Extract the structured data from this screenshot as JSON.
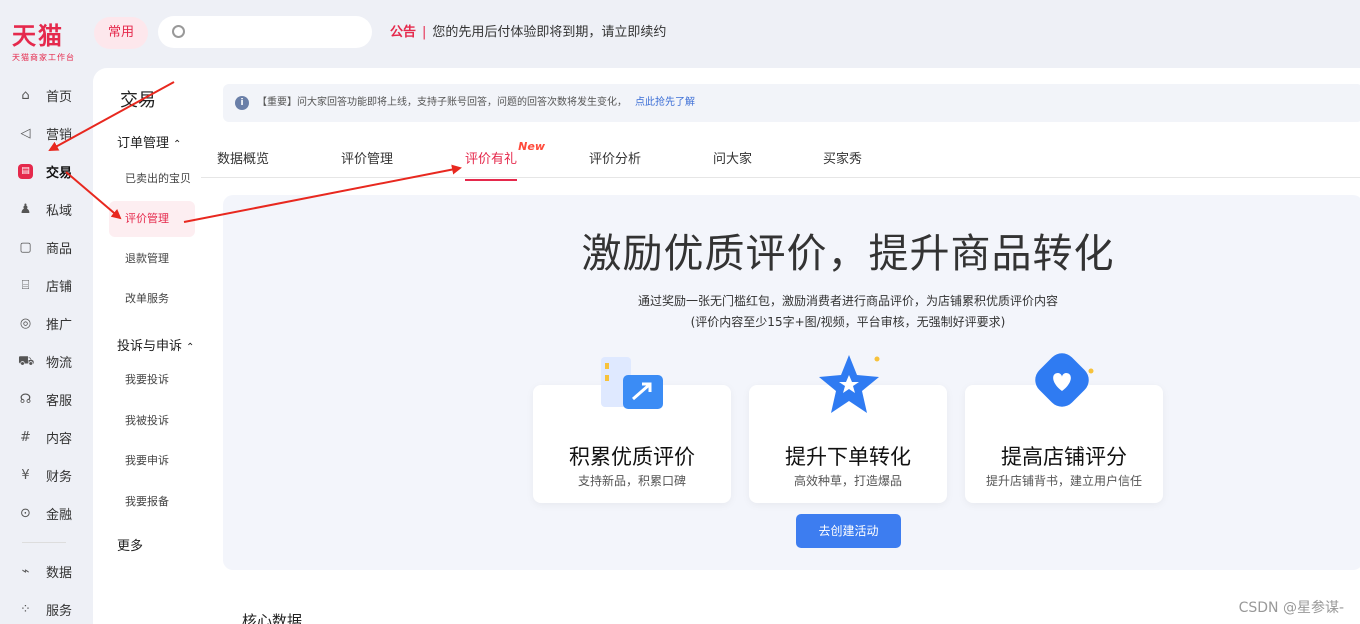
{
  "logo": {
    "main": "天猫",
    "sub": "天猫商家工作台"
  },
  "topbar": {
    "common_label": "常用",
    "search_placeholder": ""
  },
  "notice": {
    "tag": "公告",
    "separator": "|",
    "text": "您的先用后付体验即将到期，请立即续约"
  },
  "nav": {
    "items": [
      {
        "label": "首页",
        "icon": "⌂"
      },
      {
        "label": "营销",
        "icon": "◁"
      },
      {
        "label": "交易",
        "icon": "▤"
      },
      {
        "label": "私域",
        "icon": "♟"
      },
      {
        "label": "商品",
        "icon": "▢"
      },
      {
        "label": "店铺",
        "icon": "⌸"
      },
      {
        "label": "推广",
        "icon": "◎"
      },
      {
        "label": "物流",
        "icon": "⛟"
      },
      {
        "label": "客服",
        "icon": "☊"
      },
      {
        "label": "内容",
        "icon": "#"
      },
      {
        "label": "财务",
        "icon": "¥"
      },
      {
        "label": "金融",
        "icon": "⊙"
      }
    ],
    "bottom": [
      {
        "label": "数据",
        "icon": "⌁"
      },
      {
        "label": "服务",
        "icon": "⁘"
      }
    ]
  },
  "submenu": {
    "title": "交易",
    "groups": [
      {
        "label": "订单管理",
        "caret": "⌃"
      },
      {
        "label": "投诉与申诉",
        "caret": "⌃"
      },
      {
        "label": "更多",
        "caret": ""
      }
    ],
    "order_items": [
      "已卖出的宝贝",
      "评价管理",
      "退款管理",
      "改单服务"
    ],
    "complaint_items": [
      "我要投诉",
      "我被投诉",
      "我要申诉",
      "我要报备"
    ]
  },
  "banner": {
    "icon": "i",
    "text": "【重要】问大家回答功能即将上线，支持子账号回答，问题的回答次数将发生变化，",
    "link": "点此抢先了解"
  },
  "tabs": [
    {
      "label": "数据概览"
    },
    {
      "label": "评价管理"
    },
    {
      "label": "评价有礼",
      "badge": "New"
    },
    {
      "label": "评价分析"
    },
    {
      "label": "问大家"
    },
    {
      "label": "买家秀"
    }
  ],
  "hero": {
    "title": "激励优质评价，提升商品转化",
    "desc1": "通过奖励一张无门槛红包，激励消费者进行商品评价，为店铺累积优质评价内容",
    "desc2": "(评价内容至少15字+图/视频，平台审核，无强制好评要求)",
    "cards": [
      {
        "title": "积累优质评价",
        "sub": "支持新品，积累口碑",
        "icon": "chart-growth-icon"
      },
      {
        "title": "提升下单转化",
        "sub": "高效种草，打造爆品",
        "icon": "star-icon"
      },
      {
        "title": "提高店铺评分",
        "sub": "提升店铺背书，建立用户信任",
        "icon": "heart-tag-icon"
      }
    ],
    "cta": "去创建活动"
  },
  "core": {
    "title": "核心数据"
  },
  "watermark": "CSDN @星参谋-",
  "colors": {
    "brand": "#e5294c",
    "primary_button": "#3d7df0",
    "annotation_arrow": "#e8281f"
  }
}
